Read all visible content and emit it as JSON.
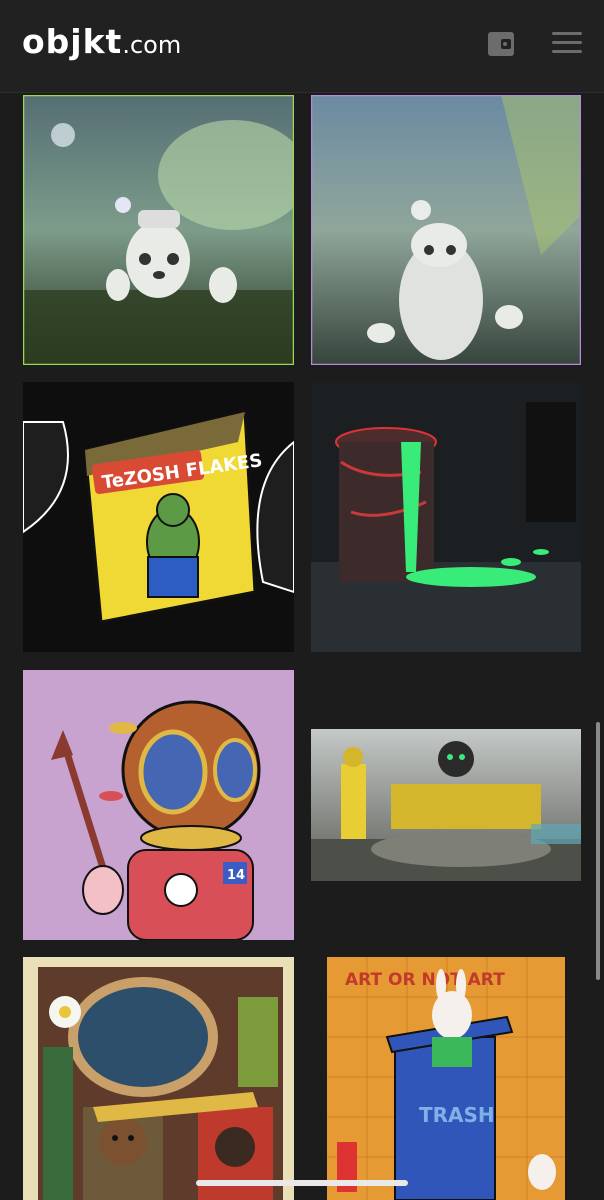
{
  "header": {
    "logo_main": "objkt",
    "logo_suffix": ".com",
    "wallet_icon": "wallet-icon",
    "menu_icon": "hamburger-menu-icon"
  },
  "gallery": {
    "items": [
      {
        "art": "white-robot-creature-waving-in-swamp"
      },
      {
        "art": "white-robot-creature-in-swamp-waterfall"
      },
      {
        "art": "turtle-on-tezosh-flakes-cereal-box",
        "text": "TeZOSH FLAKES"
      },
      {
        "art": "green-slime-trash-can-with-rats"
      },
      {
        "art": "diver-helmet-character-with-spear",
        "badge": "14"
      },
      {
        "art": "yellow-robot-and-figure-in-junkyard"
      },
      {
        "art": "collage-bear-and-horse-cards"
      },
      {
        "art": "bunny-in-blue-trash-bin",
        "text_top": "ART OR NOT ART",
        "text_mid": "TRASH"
      }
    ]
  },
  "colors": {
    "background": "#1c1c1c",
    "header": "#212121",
    "accent_green_border": "#9ad84f",
    "accent_purple_border": "#b58ad8"
  }
}
